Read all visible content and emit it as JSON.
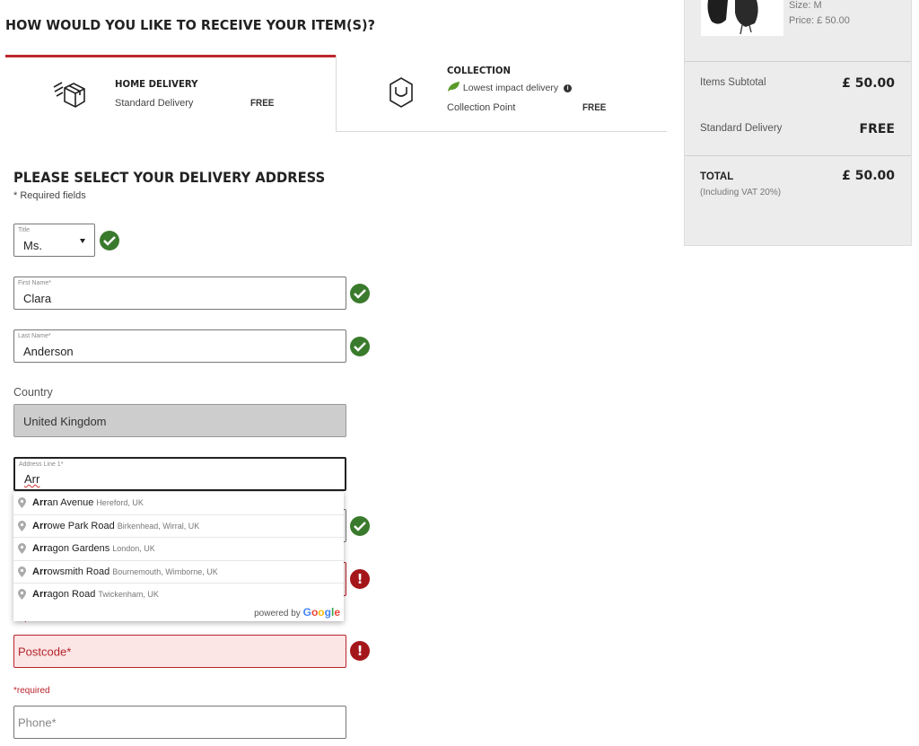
{
  "checkout": {
    "receive_heading": "HOW WOULD YOU LIKE TO RECEIVE YOUR ITEM(S)?",
    "tabs": [
      {
        "title": "HOME DELIVERY",
        "option": "Standard Delivery",
        "price": "FREE",
        "icon": "delivery-box-icon",
        "active": true
      },
      {
        "title": "COLLECTION",
        "eco": "Lowest impact delivery",
        "option": "Collection Point",
        "price": "FREE",
        "icon": "shopping-bag-icon",
        "active": false
      }
    ],
    "address_heading": "PLEASE SELECT YOUR DELIVERY ADDRESS",
    "required_note": "* Required fields"
  },
  "form": {
    "title": {
      "label": "Title",
      "value": "Ms."
    },
    "first_name": {
      "label": "First Name*",
      "value": "Clara"
    },
    "last_name": {
      "label": "Last Name*",
      "value": "Anderson"
    },
    "country": {
      "label": "Country",
      "value": "United Kingdom"
    },
    "address1": {
      "label": "Address Line 1*",
      "value": "Arr"
    },
    "address_required": "required",
    "postcode": {
      "placeholder": "Postcode*"
    },
    "postcode_required": "*required",
    "phone": {
      "placeholder": "Phone*"
    }
  },
  "autocomplete": {
    "suggestions": [
      {
        "match": "Arr",
        "rest": "an Avenue",
        "secondary": "Hereford, UK"
      },
      {
        "match": "Arr",
        "rest": "owe Park Road",
        "secondary": "Birkenhead, Wirral, UK"
      },
      {
        "match": "Arr",
        "rest": "agon Gardens",
        "secondary": "London, UK"
      },
      {
        "match": "Arr",
        "rest": "owsmith Road",
        "secondary": "Bournemouth, Wimborne, UK"
      },
      {
        "match": "Arr",
        "rest": "agon Road",
        "secondary": "Twickenham, UK"
      }
    ],
    "powered_by": "powered by",
    "google": "Google"
  },
  "summary": {
    "size": "Size: M",
    "price": "Price: £ 50.00",
    "subtotal_label": "Items Subtotal",
    "subtotal_value": "£ 50.00",
    "delivery_label": "Standard Delivery",
    "delivery_value": "FREE",
    "total_label": "TOTAL",
    "vat_note": "(Including VAT 20%)",
    "total_value": "£ 50.00"
  },
  "colors": {
    "accent": "#c0262d",
    "success": "#3a7a2c",
    "error": "#a4161a"
  }
}
